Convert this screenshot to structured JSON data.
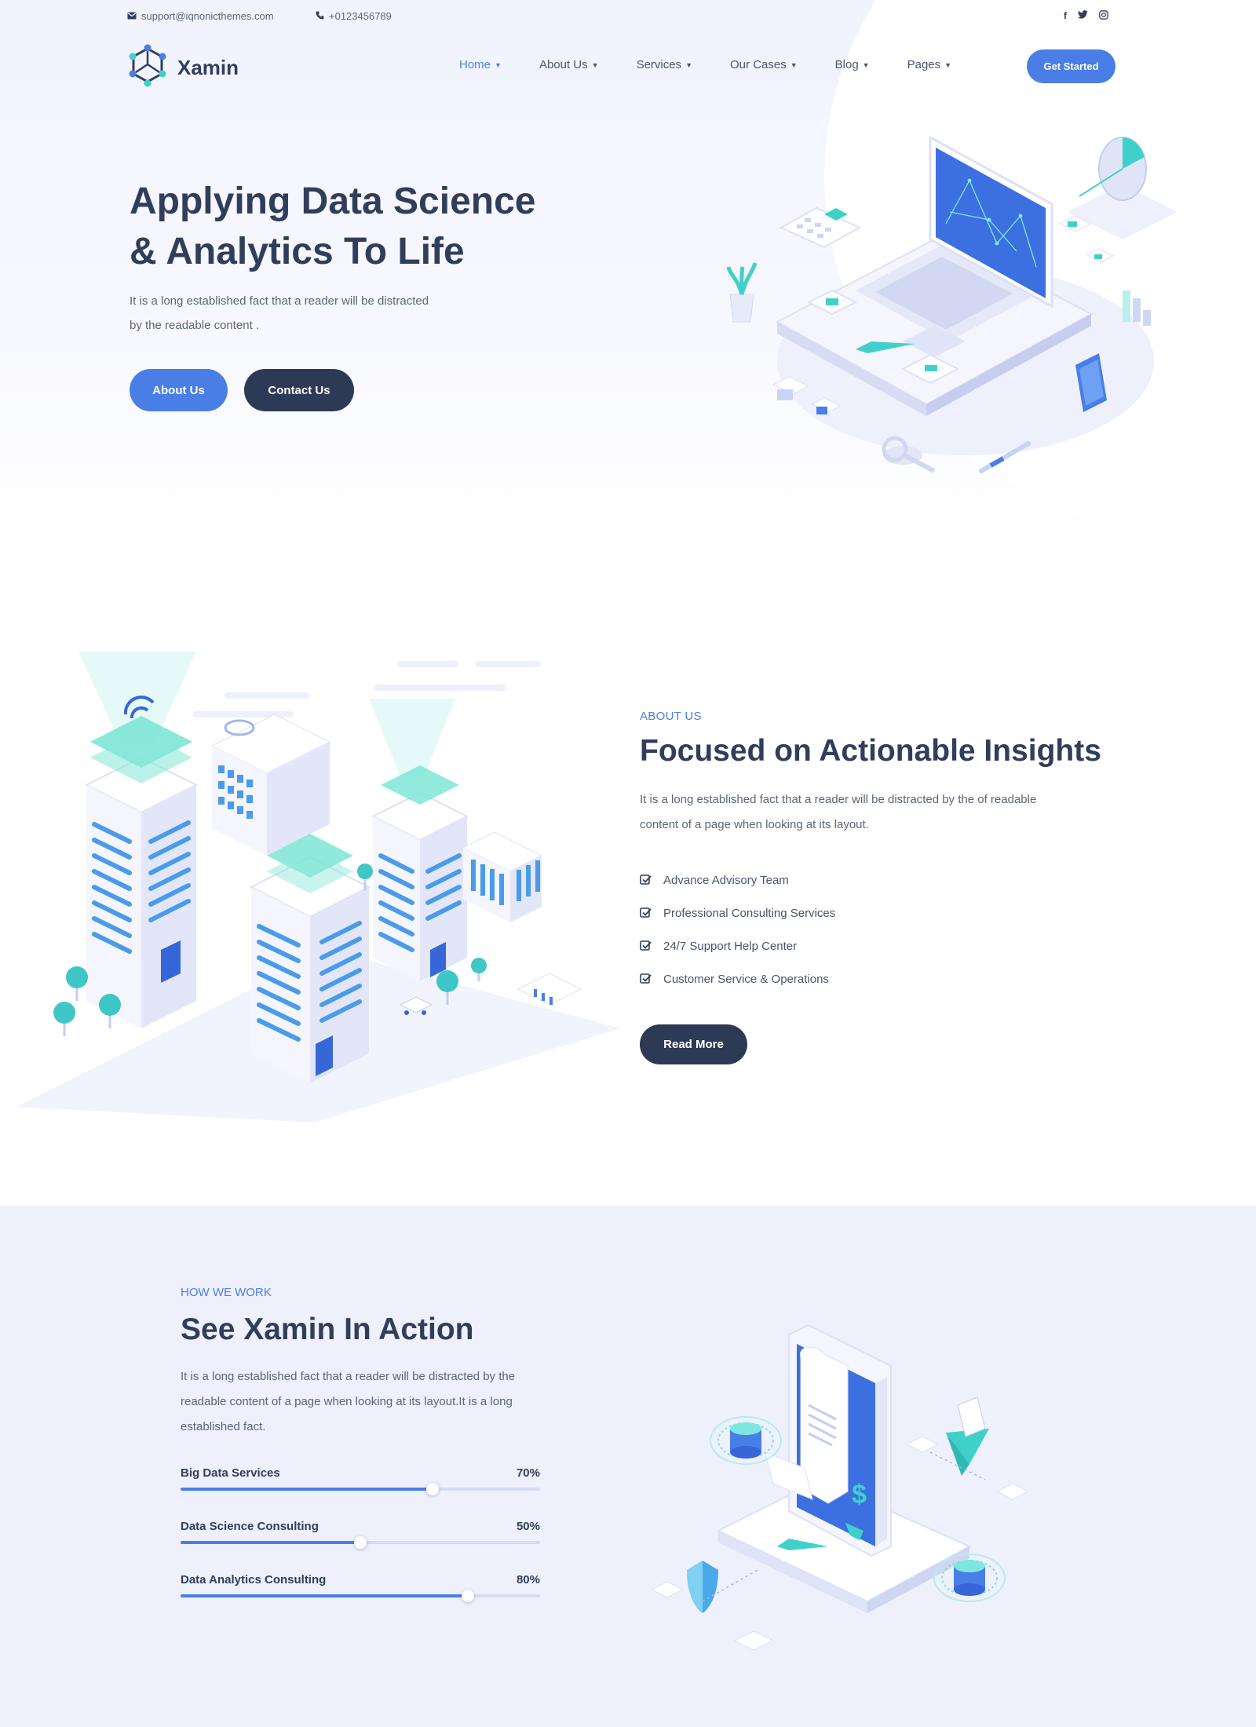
{
  "topbar": {
    "email": "support@iqnonicthemes.com",
    "phone": "+0123456789",
    "social": [
      {
        "icon": "facebook-icon",
        "glyph": "f"
      },
      {
        "icon": "twitter-icon",
        "glyph": "t"
      },
      {
        "icon": "instagram-icon",
        "glyph": "◎"
      }
    ]
  },
  "brand": {
    "name": "Xamin"
  },
  "nav": {
    "items": [
      {
        "label": "Home",
        "active": true
      },
      {
        "label": "About Us",
        "active": false
      },
      {
        "label": "Services",
        "active": false
      },
      {
        "label": "Our Cases",
        "active": false
      },
      {
        "label": "Blog",
        "active": false
      },
      {
        "label": "Pages",
        "active": false
      }
    ],
    "cta": "Get Started"
  },
  "hero": {
    "title_line1": "Applying Data Science",
    "title_line2": "& Analytics To Life",
    "text": "It is a long established fact that a reader will be distracted by the readable content .",
    "btn_primary": "About Us",
    "btn_secondary": "Contact Us"
  },
  "about": {
    "tag": "ABOUT US",
    "title": "Focused on Actionable Insights",
    "text": "It is a long established fact that a reader will be distracted by the of readable content of a page when looking at its layout.",
    "features": [
      "Advance Advisory Team",
      "Professional Consulting Services",
      "24/7 Support Help Center",
      "Customer Service & Operations"
    ],
    "button": "Read More"
  },
  "how": {
    "tag": "HOW WE WORK",
    "title": "See Xamin In Action",
    "text": "It is a long established fact that a reader will be distracted by the readable content of a page when looking at its layout.It is a long established fact.",
    "progress": [
      {
        "label": "Big Data Services",
        "percent_text": "70%",
        "value": 0.7
      },
      {
        "label": "Data Science Consulting",
        "percent_text": "50%",
        "value": 0.5
      },
      {
        "label": "Data Analytics Consulting",
        "percent_text": "80%",
        "value": 0.8
      }
    ]
  },
  "colors": {
    "accent": "#4a7ee7",
    "dark": "#2d3a56",
    "heading": "#313e5b",
    "section_bg": "#eef0fb",
    "teal": "#3fd1c9"
  }
}
